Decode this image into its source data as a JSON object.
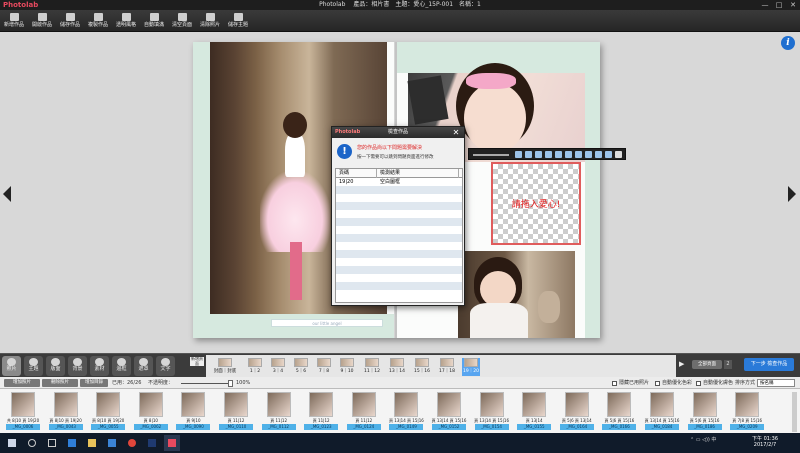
{
  "app": {
    "logo": "Photolab",
    "window_title": "Photolab",
    "product_info": "產品：相片書　主題：愛心_15P-001　名稱：1"
  },
  "window_controls": {
    "minimize": "—",
    "maximize": "□",
    "close": "✕"
  },
  "toolbar": [
    {
      "label": "新增作品"
    },
    {
      "label": "開啟作品"
    },
    {
      "label": "儲存作品"
    },
    {
      "label": "複製作品"
    },
    {
      "label": "透明風格"
    },
    {
      "label": "自動填滿"
    },
    {
      "label": "清空頁面"
    },
    {
      "label": "清除照片"
    },
    {
      "label": "儲存主題"
    }
  ],
  "info_icon": "i",
  "canvas": {
    "right_chalk": "",
    "placeholder_text": "請拖入愛心!",
    "footer_caption": "our little angel"
  },
  "dialog": {
    "logo": "Photolab",
    "title": "檢查作品",
    "close": "✕",
    "icon": "!",
    "message1": "您的作品尚以下問題需要解決",
    "message2": "按一下需要可以跳到問題頁面進行修改",
    "columns": [
      "頁碼",
      "檢測結果"
    ],
    "rows": [
      {
        "page": "19|20",
        "result": "空白圖框"
      }
    ]
  },
  "tabs": [
    {
      "label": "照片"
    },
    {
      "label": "主題"
    },
    {
      "label": "版面"
    },
    {
      "label": "背景"
    },
    {
      "label": "素材"
    },
    {
      "label": "邊框"
    },
    {
      "label": "遮罩"
    },
    {
      "label": "文字"
    }
  ],
  "add_pages": "新增頁面",
  "pages": [
    {
      "label": "封面｜封底"
    },
    {
      "label": "1｜2"
    },
    {
      "label": "3｜4"
    },
    {
      "label": "5｜6"
    },
    {
      "label": "7｜8"
    },
    {
      "label": "9｜10"
    },
    {
      "label": "11｜12"
    },
    {
      "label": "13｜14"
    },
    {
      "label": "15｜16"
    },
    {
      "label": "17｜18"
    },
    {
      "label": "19｜20",
      "selected": true
    }
  ],
  "pager": {
    "label": "全部頁面",
    "page": "2"
  },
  "action_button": "下一步 檢查作品",
  "filterbar": {
    "add_photo": "增加照片",
    "remove_photo": "刪除照片",
    "add_folder": "增加目錄",
    "used": "已用：26/26",
    "opacity_label": "不透明度：",
    "opacity_value": "100%",
    "opacity_fraction": 1.0,
    "hide_used": "隱藏已用照片",
    "auto_optimize_color": "自動優化色彩",
    "auto_optimize_skin": "自動優化膚色",
    "sort_label": "排序方式",
    "sort_value": "按名稱"
  },
  "photos": [
    {
      "used": "共 8|10 頁 19|20",
      "name": "_MG_0006"
    },
    {
      "used": "頁 8|10 頁 19|20",
      "name": "_MG_0043"
    },
    {
      "used": "頁 8|10 頁 19|20",
      "name": "_MG_0055"
    },
    {
      "used": "頁 8|10",
      "name": "_MG_0062"
    },
    {
      "used": "頁 9|10",
      "name": "_MG_0090"
    },
    {
      "used": "頁 11|12",
      "name": "_MG_0110"
    },
    {
      "used": "頁 11|12",
      "name": "_MG_0112"
    },
    {
      "used": "頁 11|12",
      "name": "_MG_0123"
    },
    {
      "used": "頁 11|12",
      "name": "_MG_0124"
    },
    {
      "used": "頁 13|14 頁 15|16",
      "name": "_MG_0149"
    },
    {
      "used": "頁 13|14 頁 15|16",
      "name": "_MG_0152"
    },
    {
      "used": "頁 13|14 頁 15|16",
      "name": "_MG_0154"
    },
    {
      "used": "頁 13|14",
      "name": "_MG_0155"
    },
    {
      "used": "頁 5|6 頁 13|14",
      "name": "_MG_0164"
    },
    {
      "used": "頁 5|6 頁 15|16",
      "name": "_MG_0166"
    },
    {
      "used": "頁 13|14 頁 15|16",
      "name": "_MG_0184"
    },
    {
      "used": "頁 5|6 頁 15|16",
      "name": "_MG_0186"
    },
    {
      "used": "頁 7|8 頁 15|16",
      "name": "_MG_0209"
    }
  ],
  "taskbar": {
    "clock_time": "下午 01:36",
    "clock_date": "2017/2/7",
    "tray": "⌃ ▭ ◁))  中"
  },
  "colors": {
    "accent": "#2a7ad8",
    "dialog_red": "#d22222",
    "placeholder_border": "#e05c5c",
    "selected_page": "#58a5f0",
    "photo_label": "#4fb1e8"
  }
}
